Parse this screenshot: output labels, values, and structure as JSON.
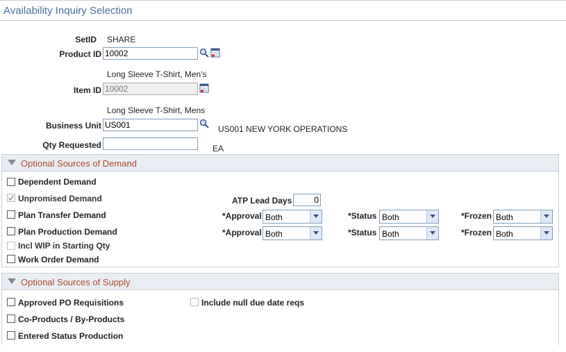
{
  "page_title": "Availability Inquiry Selection",
  "fields": {
    "setid_label": "SetID",
    "setid_value": "SHARE",
    "product_label": "Product ID",
    "product_value": "10002",
    "product_desc": "Long Sleeve T-Shirt, Men's",
    "item_label": "Item ID",
    "item_value": "10002",
    "item_desc": "Long Sleeve T-Shirt, Mens",
    "bu_label": "Business Unit",
    "bu_value": "US001",
    "bu_desc": "US001 NEW YORK OPERATIONS",
    "qty_label": "Qty Requested",
    "qty_value": "",
    "qty_uom": "EA"
  },
  "demand": {
    "header": "Optional Sources of Demand",
    "dependent": "Dependent Demand",
    "unpromised": "Unpromised Demand",
    "plan_transfer": "Plan Transfer Demand",
    "plan_production": "Plan Production Demand",
    "incl_wip": "Incl WIP in Starting Qty",
    "work_order": "Work Order Demand",
    "atp_label": "ATP Lead Days",
    "atp_value": "0",
    "approval_label": "*Approval",
    "status_label": "*Status",
    "frozen_label": "*Frozen",
    "row1": {
      "approval": "Both",
      "status": "Both",
      "frozen": "Both"
    },
    "row2": {
      "approval": "Both",
      "status": "Both",
      "frozen": "Both"
    }
  },
  "supply": {
    "header": "Optional Sources of Supply",
    "approved_po": "Approved PO Requisitions",
    "include_null": "Include null due date reqs",
    "coproducts": "Co-Products / By-Products",
    "entered_status": "Entered Status Production"
  }
}
